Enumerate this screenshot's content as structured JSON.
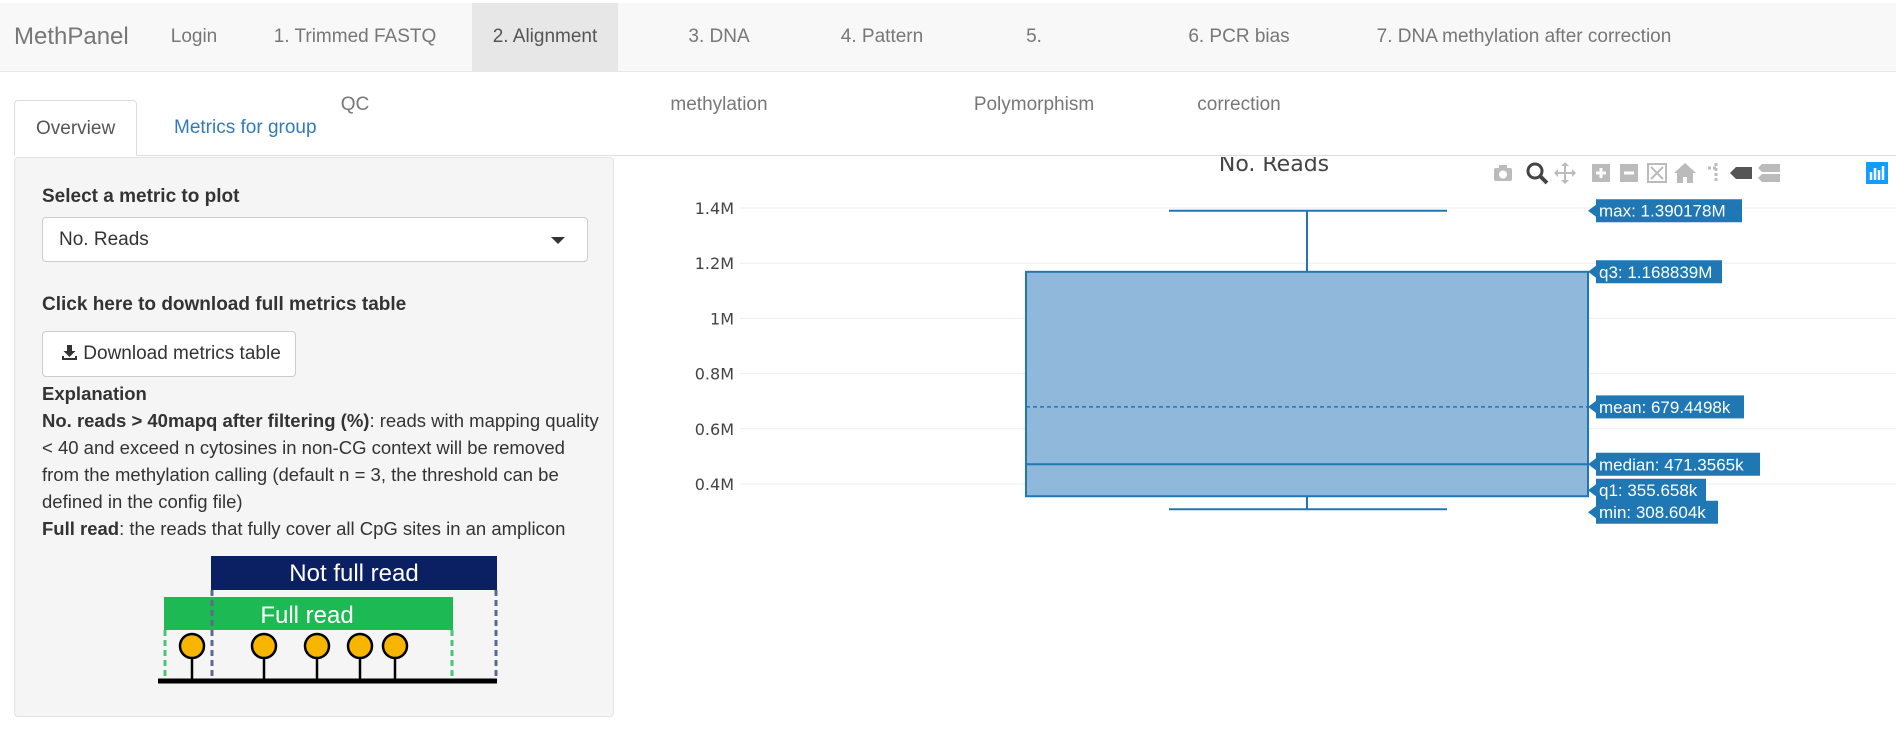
{
  "navbar": {
    "brand": "MethPanel",
    "items": [
      {
        "label": "Login",
        "active": false
      },
      {
        "label": "1. Trimmed FASTQ QC",
        "active": false
      },
      {
        "label": "2. Alignment",
        "active": true
      },
      {
        "label": "3. DNA methylation",
        "active": false
      },
      {
        "label": "4. Pattern",
        "active": false
      },
      {
        "label": "5. Polymorphism",
        "active": false
      },
      {
        "label": "6. PCR bias correction",
        "active": false
      },
      {
        "label": "7. DNA methylation after correction",
        "active": false
      }
    ]
  },
  "tabs": [
    {
      "label": "Overview",
      "active": true
    },
    {
      "label": "Metrics for group",
      "active": false
    }
  ],
  "sidebar": {
    "select_label": "Select a metric to plot",
    "select_value": "No. Reads",
    "download_label": "Click here to download full metrics table",
    "download_button": "Download metrics table",
    "explanation_title": "Explanation",
    "expl1_term": "No. reads > 40mapq after filtering (%)",
    "expl1_text": ": reads with mapping quality < 40 and exceed n cytosines in non-CG context will be removed from the methylation calling (default n = 3, the threshold can be defined in the config file)",
    "expl2_term": "Full read",
    "expl2_text": ": the reads that fully cover all CpG sites in an amplicon",
    "figure": {
      "not_full_read": "Not full read",
      "full_read": "Full read"
    }
  },
  "modebar": {
    "icons": [
      "camera-icon",
      "zoom-icon",
      "pan-icon",
      "zoom-in-icon",
      "zoom-out-icon",
      "autoscale-icon",
      "reset-axes-icon",
      "spike-lines-icon",
      "hover-closest-icon",
      "hover-compare-icon",
      "plotly-logo-icon"
    ]
  },
  "chart_data": {
    "type": "box",
    "title": "No. Reads",
    "xlabel": "",
    "ylabel": "",
    "ylim": [
      0.27,
      1.47
    ],
    "y_ticks": [
      {
        "value": 0.4,
        "label": "0.4M"
      },
      {
        "value": 0.6,
        "label": "0.6M"
      },
      {
        "value": 0.8,
        "label": "0.8M"
      },
      {
        "value": 1.0,
        "label": "1M"
      },
      {
        "value": 1.2,
        "label": "1.2M"
      },
      {
        "value": 1.4,
        "label": "1.4M"
      }
    ],
    "box": {
      "min": 0.308604,
      "q1": 0.355658,
      "median": 0.4713565,
      "mean": 0.6794498,
      "q3": 1.168839,
      "max": 1.390178
    },
    "hover_labels": {
      "max": "max: 1.390178M",
      "q3": "q3: 1.168839M",
      "mean": "mean: 679.4498k",
      "median": "median: 471.3565k",
      "q1": "q1: 355.658k",
      "min": "min: 308.604k"
    },
    "colors": {
      "box_fill": "#8fb8da",
      "box_line": "#1f77b4",
      "tooltip": "#1f77b4"
    },
    "grid": true
  }
}
